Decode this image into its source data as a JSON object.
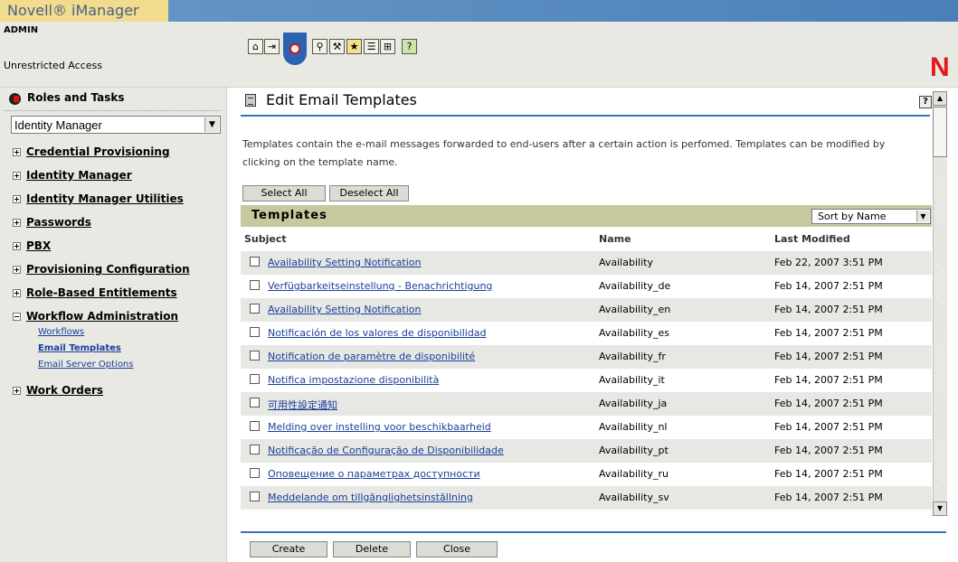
{
  "app": {
    "brand": "Novell® iManager",
    "user": "ADMIN",
    "access": "Unrestricted Access",
    "logo_letter": "N"
  },
  "toolbar": {
    "icons": [
      "home-icon",
      "exit-icon",
      "roles-tasks-icon",
      "view-objects-icon",
      "configure-icon",
      "favorites-icon",
      "preferences-icon",
      "hierarchy-icon",
      "help-icon"
    ]
  },
  "sidebar": {
    "header": "Roles and Tasks",
    "role_select": "Identity Manager",
    "categories": [
      {
        "label": "Credential Provisioning"
      },
      {
        "label": "Identity Manager"
      },
      {
        "label": "Identity Manager Utilities"
      },
      {
        "label": "Passwords"
      },
      {
        "label": "PBX"
      },
      {
        "label": "Provisioning Configuration"
      },
      {
        "label": "Role-Based Entitlements"
      },
      {
        "label": "Workflow Administration"
      },
      {
        "label": "Work Orders"
      }
    ],
    "workflow_subitems": [
      "Workflows",
      "Email Templates",
      "Email Server Options"
    ]
  },
  "main": {
    "title": "Edit Email Templates",
    "help": "?",
    "intro_line1": "Templates contain the e-mail messages forwarded to end-users after a certain action is perfomed. Templates can be modified by",
    "intro_line2": "clicking on the template name.",
    "select_all": "Select All",
    "deselect_all": "Deselect All",
    "section_title": "Templates",
    "sort_select": "Sort by Name",
    "columns": {
      "subject": "Subject",
      "name": "Name",
      "modified": "Last Modified"
    },
    "rows": [
      {
        "subject": "Availability Setting Notification",
        "name": "Availability",
        "modified": "Feb 22, 2007 3:51 PM"
      },
      {
        "subject": "Verfügbarkeitseinstellung - Benachrichtigung",
        "name": "Availability_de",
        "modified": "Feb 14, 2007 2:51 PM"
      },
      {
        "subject": "Availability Setting Notification",
        "name": "Availability_en",
        "modified": "Feb 14, 2007 2:51 PM"
      },
      {
        "subject": "Notificación de los valores de disponibilidad",
        "name": "Availability_es",
        "modified": "Feb 14, 2007 2:51 PM"
      },
      {
        "subject": "Notification de paramètre de disponibilité",
        "name": "Availability_fr",
        "modified": "Feb 14, 2007 2:51 PM"
      },
      {
        "subject": "Notifica impostazione disponibilità",
        "name": "Availability_it",
        "modified": "Feb 14, 2007 2:51 PM"
      },
      {
        "subject": "可用性設定通知",
        "name": "Availability_ja",
        "modified": "Feb 14, 2007 2:51 PM"
      },
      {
        "subject": "Melding over instelling voor beschikbaarheid",
        "name": "Availability_nl",
        "modified": "Feb 14, 2007 2:51 PM"
      },
      {
        "subject": "Notificação de Configuração de Disponibilidade",
        "name": "Availability_pt",
        "modified": "Feb 14, 2007 2:51 PM"
      },
      {
        "subject": "Оповещение о параметрах доступности",
        "name": "Availability_ru",
        "modified": "Feb 14, 2007 2:51 PM"
      },
      {
        "subject": "Meddelande om tillgänglighetsinställning",
        "name": "Availability_sv",
        "modified": "Feb 14, 2007 2:51 PM"
      }
    ],
    "create": "Create",
    "delete": "Delete",
    "close": "Close"
  }
}
